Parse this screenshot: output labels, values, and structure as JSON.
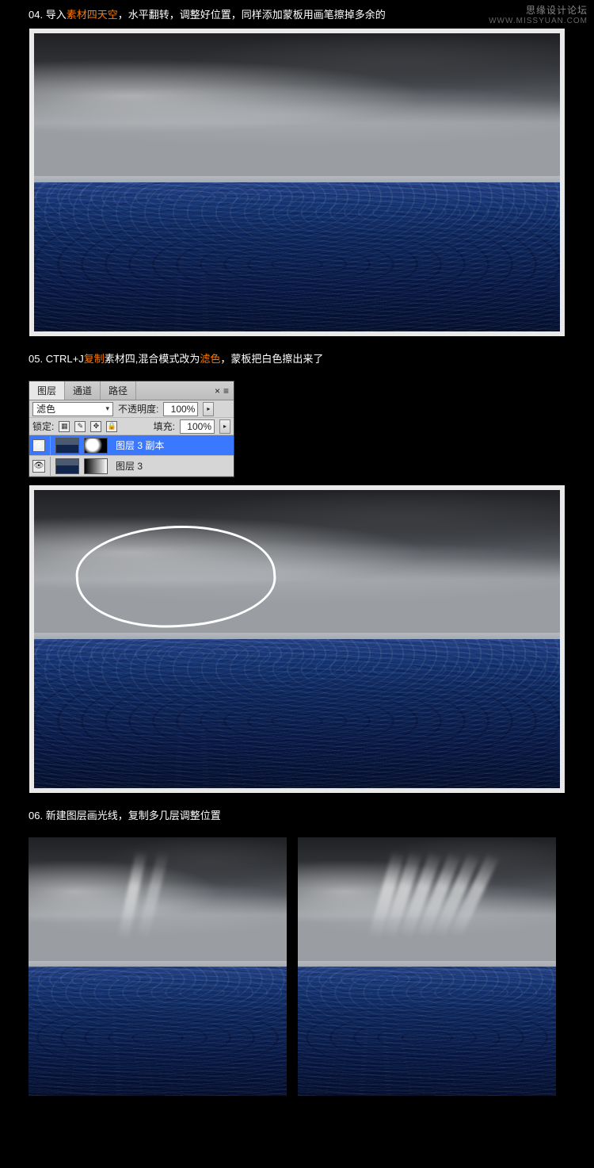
{
  "watermark": {
    "title": "思缘设计论坛",
    "url": "WWW.MISSYUAN.COM"
  },
  "steps": {
    "s04": {
      "num": "04.",
      "prefix": "导入",
      "hl": "素材四天空",
      "rest": "，水平翻转，调整好位置，同样添加蒙板用画笔擦掉多余的"
    },
    "s05": {
      "num": "05.",
      "prefix": "CTRL+J",
      "hl1": "复制",
      "mid": "素材四,混合模式改为",
      "hl2": "滤色",
      "rest": "，蒙板把白色擦出来了"
    },
    "s06": {
      "num": "06.",
      "text": "新建图层画光线，复制多几层调整位置"
    }
  },
  "panel": {
    "tabs": {
      "layers": "图层",
      "channels": "通道",
      "paths": "路径"
    },
    "blend_mode": "滤色",
    "opacity_label": "不透明度:",
    "opacity_value": "100%",
    "lock_label": "锁定:",
    "fill_label": "填充:",
    "fill_value": "100%",
    "layers": [
      {
        "name": "图层 3 副本",
        "selected": true,
        "mask": "spot"
      },
      {
        "name": "图层 3",
        "selected": false,
        "mask": "grad"
      }
    ]
  },
  "icons": {
    "eye": "👁",
    "close": "×",
    "menu": "≡",
    "flyout": "▸",
    "dropdown": "▾",
    "lock_trans": "▦",
    "lock_brush": "✎",
    "lock_move": "✥",
    "lock_all": "🔒"
  }
}
